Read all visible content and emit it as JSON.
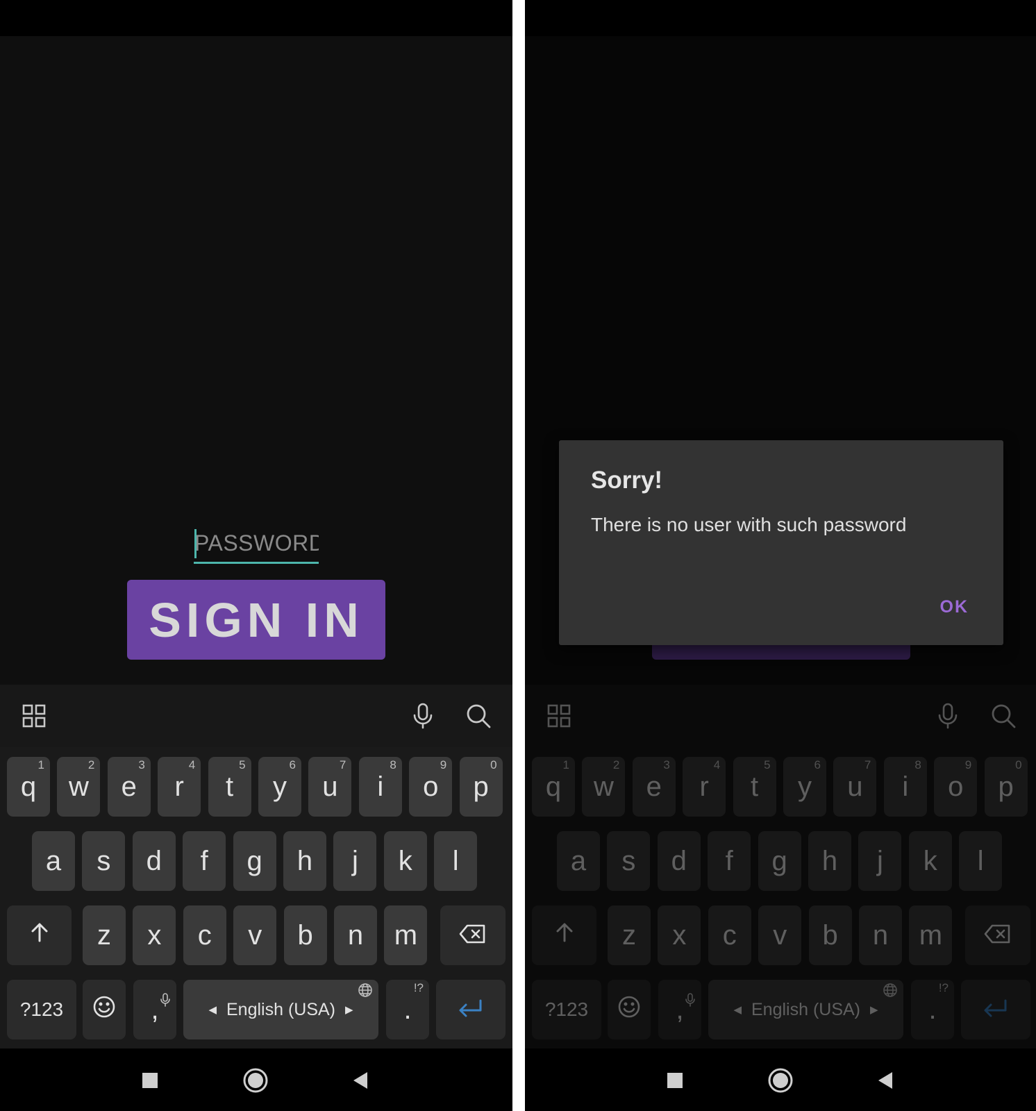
{
  "login_screen": {
    "password_placeholder": "PASSWORD",
    "sign_in_label": "SIGN IN"
  },
  "dialog": {
    "title": "Sorry!",
    "message": "There is no user with such password",
    "ok_label": "OK"
  },
  "keyboard": {
    "row1": [
      {
        "key": "q",
        "hint": "1"
      },
      {
        "key": "w",
        "hint": "2"
      },
      {
        "key": "e",
        "hint": "3"
      },
      {
        "key": "r",
        "hint": "4"
      },
      {
        "key": "t",
        "hint": "5"
      },
      {
        "key": "y",
        "hint": "6"
      },
      {
        "key": "u",
        "hint": "7"
      },
      {
        "key": "i",
        "hint": "8"
      },
      {
        "key": "o",
        "hint": "9"
      },
      {
        "key": "p",
        "hint": "0"
      }
    ],
    "row2": [
      "a",
      "s",
      "d",
      "f",
      "g",
      "h",
      "j",
      "k",
      "l"
    ],
    "row3": [
      "z",
      "x",
      "c",
      "v",
      "b",
      "n",
      "m"
    ],
    "symbols_label": "?123",
    "comma_label": ",",
    "language_label": "English (USA)",
    "period_label": ".",
    "period_hint": "!?"
  },
  "colors": {
    "accent_purple": "#6a42a2",
    "cursor_teal": "#4db6ac",
    "dialog_ok": "#9c6ad6",
    "enter_blue": "#3b82c4"
  },
  "icons": {
    "toolbar": [
      "grid-icon",
      "mic-icon",
      "search-icon"
    ],
    "keys": [
      "shift-icon",
      "backspace-icon",
      "emoji-icon",
      "enter-icon",
      "globe-icon"
    ],
    "nav": [
      "recents-icon",
      "home-icon",
      "back-icon"
    ]
  }
}
